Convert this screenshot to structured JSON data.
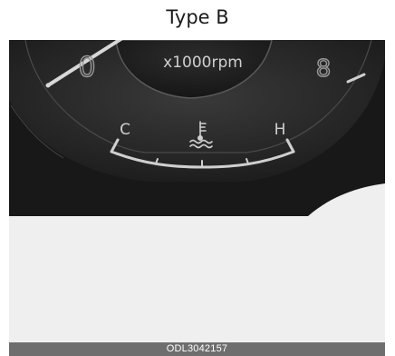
{
  "figure": {
    "title": "Type B",
    "rpm_unit_label": "x1000rpm",
    "tacho_left_numeral": "0",
    "tacho_right_numeral": "8",
    "temp_gauge": {
      "cold_label": "C",
      "hot_label": "H",
      "icon": "coolant-temperature-icon"
    },
    "figure_code": "ODL3042157"
  }
}
